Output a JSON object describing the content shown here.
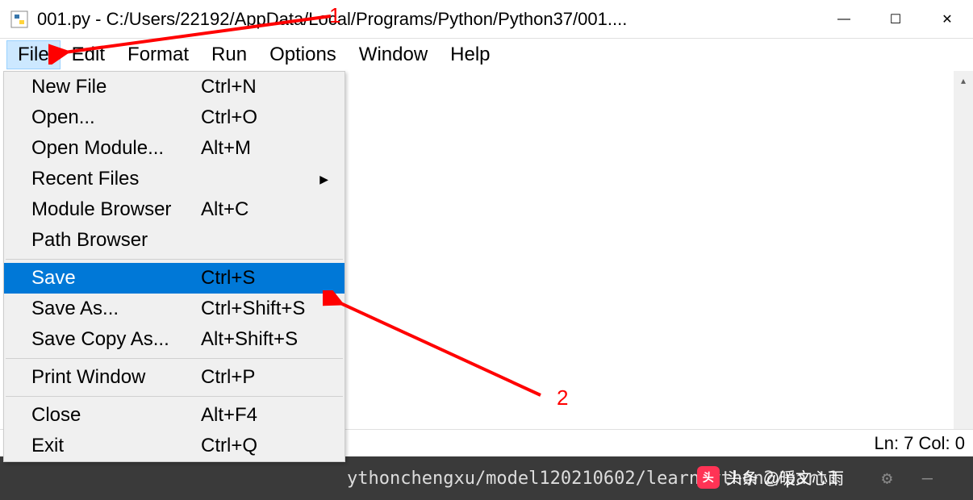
{
  "window": {
    "title": "001.py - C:/Users/22192/AppData/Local/Programs/Python/Python37/001....",
    "controls": {
      "minimize": "—",
      "maximize": "☐",
      "close": "✕"
    }
  },
  "menubar": {
    "items": [
      {
        "label": "File",
        "active": true
      },
      {
        "label": "Edit",
        "active": false
      },
      {
        "label": "Format",
        "active": false
      },
      {
        "label": "Run",
        "active": false
      },
      {
        "label": "Options",
        "active": false
      },
      {
        "label": "Window",
        "active": false
      },
      {
        "label": "Help",
        "active": false
      }
    ]
  },
  "file_menu": {
    "groups": [
      [
        {
          "label": "New File",
          "shortcut": "Ctrl+N",
          "submenu": false,
          "highlighted": false
        },
        {
          "label": "Open...",
          "shortcut": "Ctrl+O",
          "submenu": false,
          "highlighted": false
        },
        {
          "label": "Open Module...",
          "shortcut": "Alt+M",
          "submenu": false,
          "highlighted": false
        },
        {
          "label": "Recent Files",
          "shortcut": "",
          "submenu": true,
          "highlighted": false
        },
        {
          "label": "Module Browser",
          "shortcut": "Alt+C",
          "submenu": false,
          "highlighted": false
        },
        {
          "label": "Path Browser",
          "shortcut": "",
          "submenu": false,
          "highlighted": false
        }
      ],
      [
        {
          "label": "Save",
          "shortcut": "Ctrl+S",
          "submenu": false,
          "highlighted": true
        },
        {
          "label": "Save As...",
          "shortcut": "Ctrl+Shift+S",
          "submenu": false,
          "highlighted": false
        },
        {
          "label": "Save Copy As...",
          "shortcut": "Alt+Shift+S",
          "submenu": false,
          "highlighted": false
        }
      ],
      [
        {
          "label": "Print Window",
          "shortcut": "Ctrl+P",
          "submenu": false,
          "highlighted": false
        }
      ],
      [
        {
          "label": "Close",
          "shortcut": "Alt+F4",
          "submenu": false,
          "highlighted": false
        },
        {
          "label": "Exit",
          "shortcut": "Ctrl+Q",
          "submenu": false,
          "highlighted": false
        }
      ]
    ]
  },
  "statusbar": {
    "position": "Ln: 7  Col: 0"
  },
  "terminal": {
    "path": "ythonchengxu/model120210602/learnpython2/part1"
  },
  "annotations": {
    "label1": "1",
    "label2": "2"
  },
  "watermark": {
    "prefix": "头条",
    "user": "@暖文心雨"
  }
}
